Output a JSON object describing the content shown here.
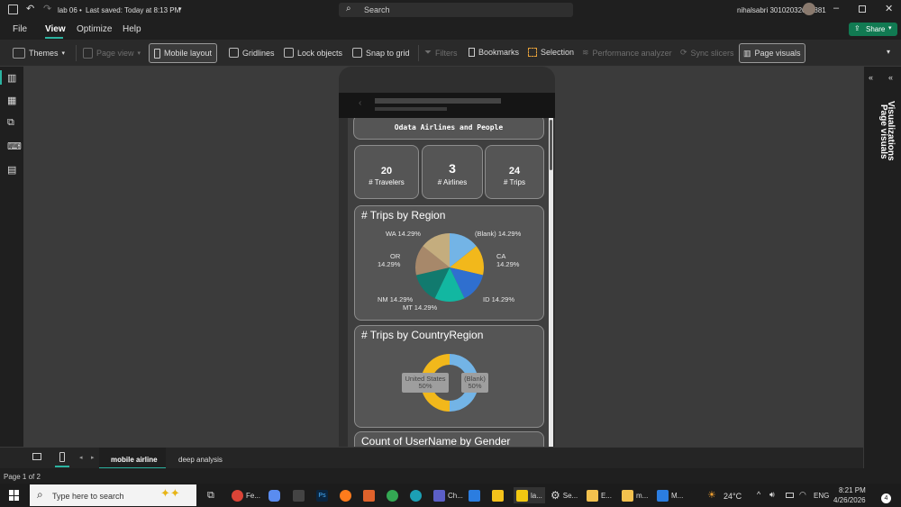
{
  "titlebar": {
    "file_name": "lab 06",
    "saved": "Last saved: Today at 8:13 PM",
    "search_placeholder": "Search",
    "user": "nihalsabri 30102032601881"
  },
  "menu": {
    "file": "File",
    "view": "View",
    "optimize": "Optimize",
    "help": "Help",
    "share": "Share"
  },
  "ribbon": {
    "themes": "Themes",
    "page_view": "Page view",
    "mobile_layout": "Mobile layout",
    "gridlines": "Gridlines",
    "lock_objects": "Lock objects",
    "snap_to_grid": "Snap to grid",
    "filters": "Filters",
    "bookmarks": "Bookmarks",
    "selection": "Selection",
    "performance_analyzer": "Performance analyzer",
    "sync_slicers": "Sync slicers",
    "page_visuals": "Page visuals"
  },
  "report": {
    "title": "Odata Airlines and People",
    "kpis": [
      {
        "value": "20",
        "label": "# Travelers"
      },
      {
        "value": "3",
        "label": "# Airlines"
      },
      {
        "value": "24",
        "label": "# Trips"
      }
    ],
    "trips_by_region": {
      "title": "# Trips by Region",
      "labels": {
        "wa": "WA 14.29%",
        "blank": "(Blank) 14.29%",
        "ca1": "CA",
        "ca2": "14.29%",
        "or1": "OR",
        "or2": "14.29%",
        "id": "ID 14.29%",
        "nm": "NM 14.29%",
        "mt": "MT 14.29%"
      }
    },
    "trips_by_country": {
      "title": "# Trips by CountryRegion",
      "us1": "United States",
      "us2": "50%",
      "bl1": "(Blank)",
      "bl2": "50%"
    },
    "gender_title": "Count of UserName by Gender"
  },
  "chart_data": [
    {
      "type": "pie",
      "title": "# Trips by Region",
      "categories": [
        "(Blank)",
        "CA",
        "ID",
        "MT",
        "NM",
        "OR",
        "WA"
      ],
      "values": [
        14.29,
        14.29,
        14.29,
        14.29,
        14.29,
        14.29,
        14.29
      ],
      "colors": [
        "#73b4e6",
        "#f2b81b",
        "#2f6fcf",
        "#12b7a1",
        "#117a6e",
        "#a7886a",
        "#c4ad7e"
      ]
    },
    {
      "type": "pie",
      "title": "# Trips by CountryRegion",
      "categories": [
        "(Blank)",
        "United States"
      ],
      "values": [
        50,
        50
      ],
      "colors": [
        "#73b4e6",
        "#f2b81b"
      ]
    }
  ],
  "right_panes": {
    "visualizations": "Visualizations",
    "page_visuals": "Page visuals"
  },
  "tabs": [
    {
      "label": "mobile airline"
    },
    {
      "label": "deep analysis"
    }
  ],
  "status": {
    "page": "Page 1 of 2"
  },
  "taskbar": {
    "search_placeholder": "Type here to search",
    "apps": [
      "Fe...",
      "Ch...",
      "la...",
      "Se...",
      "E...",
      "m...",
      "M..."
    ],
    "temperature": "24°C",
    "language": "ENG",
    "time": "8:21 PM",
    "date": "4/26/2026",
    "notifications": "4"
  }
}
